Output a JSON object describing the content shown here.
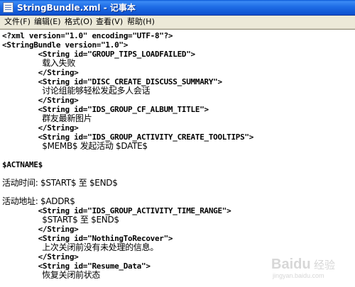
{
  "window": {
    "title": "StringBundle.xml - 记事本"
  },
  "menu": [
    {
      "label": "文件(F)"
    },
    {
      "label": "编辑(E)"
    },
    {
      "label": "格式(O)"
    },
    {
      "label": "查看(V)"
    },
    {
      "label": "帮助(H)"
    }
  ],
  "lines": [
    "<?xml version=\"1.0\" encoding=\"UTF-8\"?>",
    "<StringBundle version=\"1.0\">",
    "        <String id=\"GROUP_TIPS_LOADFAILED\">",
    "                载入失败",
    "        </String>",
    "        <String id=\"DISC_CREATE_DISCUSS_SUMMARY\">",
    "                讨论组能够轻松发起多人会话",
    "        </String>",
    "        <String id=\"IDS_GROUP_CF_ALBUM_TITLE\">",
    "                群友最新图片",
    "        </String>",
    "        <String id=\"IDS_GROUP_ACTIVITY_CREATE_TOOLTIPS\">",
    "                $MEMB$ 发起活动 $DATE$",
    "",
    "$ACTNAME$",
    "",
    "活动时间: $START$ 至 $END$",
    "",
    "活动地址: $ADDR$",
    "        <String id=\"IDS_GROUP_ACTIVITY_TIME_RANGE\">",
    "                $START$ 至 $END$",
    "        </String>",
    "        <String id=\"NothingToRecover\">",
    "                上次关闭前没有未处理的信息。",
    "        </String>",
    "        <String id=\"Resume_Data\">",
    "                恢复关闭前状态"
  ],
  "watermark": {
    "brand": "Baidu",
    "suffix": "经验",
    "url": "jingyan.baidu.com"
  }
}
